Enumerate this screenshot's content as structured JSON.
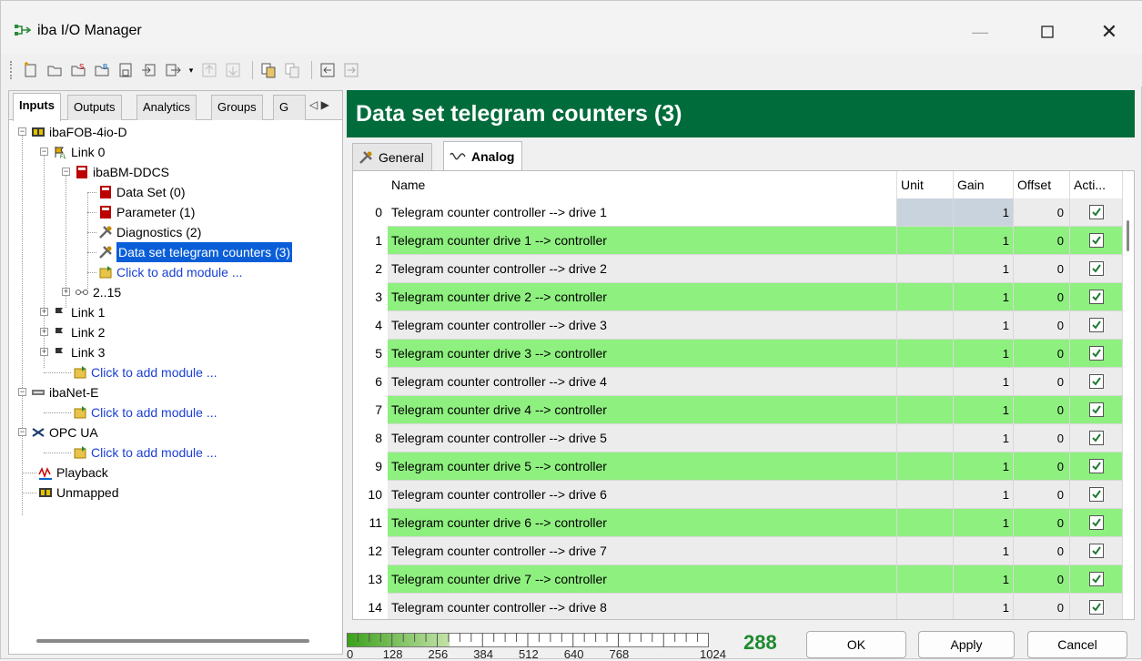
{
  "window": {
    "title": "iba I/O Manager"
  },
  "left_tabs": [
    "Inputs",
    "Outputs",
    "Analytics",
    "Groups",
    "G"
  ],
  "tree": {
    "fob": "ibaFOB-4io-D",
    "link0": "Link 0",
    "bm": "ibaBM-DDCS",
    "dataset": "Data Set (0)",
    "parameter": "Parameter (1)",
    "diagnostics": "Diagnostics (2)",
    "telegram": "Data set telegram counters (3)",
    "add_module": "Click to add module ...",
    "range": "2..15",
    "link1": "Link 1",
    "link2": "Link 2",
    "link3": "Link 3",
    "netE": "ibaNet-E",
    "opc": "OPC UA",
    "playback": "Playback",
    "unmapped": "Unmapped"
  },
  "header": {
    "title": "Data set telegram counters (3)"
  },
  "right_tabs": {
    "general": "General",
    "analog": "Analog"
  },
  "columns": {
    "name": "Name",
    "unit": "Unit",
    "gain": "Gain",
    "offset": "Offset",
    "active": "Acti..."
  },
  "rows": [
    {
      "idx": "0",
      "name": "Telegram counter controller --> drive 1",
      "unit": "",
      "gain": "1",
      "offset": "0"
    },
    {
      "idx": "1",
      "name": "Telegram counter drive 1 --> controller",
      "unit": "",
      "gain": "1",
      "offset": "0"
    },
    {
      "idx": "2",
      "name": "Telegram counter controller --> drive 2",
      "unit": "",
      "gain": "1",
      "offset": "0"
    },
    {
      "idx": "3",
      "name": "Telegram counter drive 2 --> controller",
      "unit": "",
      "gain": "1",
      "offset": "0"
    },
    {
      "idx": "4",
      "name": "Telegram counter controller --> drive 3",
      "unit": "",
      "gain": "1",
      "offset": "0"
    },
    {
      "idx": "5",
      "name": "Telegram counter drive 3 --> controller",
      "unit": "",
      "gain": "1",
      "offset": "0"
    },
    {
      "idx": "6",
      "name": "Telegram counter controller --> drive 4",
      "unit": "",
      "gain": "1",
      "offset": "0"
    },
    {
      "idx": "7",
      "name": "Telegram counter drive 4 --> controller",
      "unit": "",
      "gain": "1",
      "offset": "0"
    },
    {
      "idx": "8",
      "name": "Telegram counter controller --> drive 5",
      "unit": "",
      "gain": "1",
      "offset": "0"
    },
    {
      "idx": "9",
      "name": "Telegram counter drive 5 --> controller",
      "unit": "",
      "gain": "1",
      "offset": "0"
    },
    {
      "idx": "10",
      "name": "Telegram counter controller --> drive 6",
      "unit": "",
      "gain": "1",
      "offset": "0"
    },
    {
      "idx": "11",
      "name": "Telegram counter drive 6 --> controller",
      "unit": "",
      "gain": "1",
      "offset": "0"
    },
    {
      "idx": "12",
      "name": "Telegram counter controller --> drive 7",
      "unit": "",
      "gain": "1",
      "offset": "0"
    },
    {
      "idx": "13",
      "name": "Telegram counter drive 7 --> controller",
      "unit": "",
      "gain": "1",
      "offset": "0"
    },
    {
      "idx": "14",
      "name": "Telegram counter controller --> drive 8",
      "unit": "",
      "gain": "1",
      "offset": "0"
    }
  ],
  "gauge": {
    "labels": [
      "0",
      "128",
      "256",
      "384",
      "512",
      "640",
      "768",
      "1024"
    ],
    "value": 288,
    "max": 1024
  },
  "count": "288",
  "buttons": {
    "ok": "OK",
    "apply": "Apply",
    "cancel": "Cancel"
  },
  "colors": {
    "header": "#006c3b",
    "odd_row": "#8ef07f",
    "selection": "#0a5fd8",
    "link": "#1a3fd4"
  }
}
